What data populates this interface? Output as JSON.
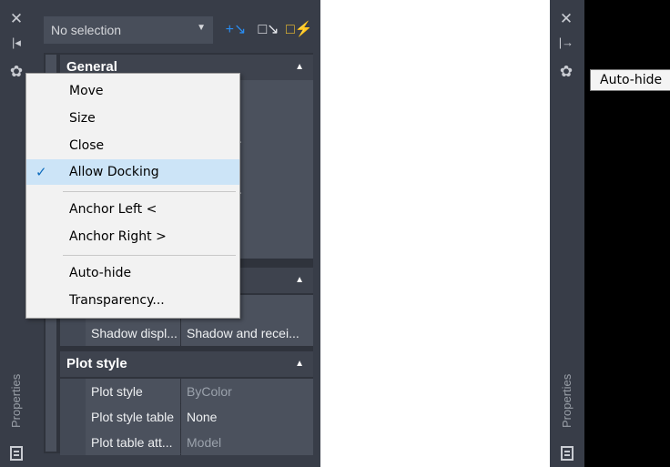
{
  "left": {
    "title_vertical": "Properties",
    "selection_combo": "No selection",
    "sections": [
      {
        "title": "General"
      },
      {
        "title": "Plot style"
      }
    ],
    "behind_values": [
      "yer",
      "- ByLayer",
      "- ByLayer"
    ],
    "shadow_row": {
      "name": "Shadow displ...",
      "value": "Shadow and recei..."
    },
    "plot_rows": [
      {
        "name": "Plot style",
        "value": "ByColor"
      },
      {
        "name": "Plot style table",
        "value": "None"
      },
      {
        "name": "Plot table att...",
        "value": "Model"
      }
    ]
  },
  "menu": {
    "items": [
      {
        "label": "Move"
      },
      {
        "label": "Size"
      },
      {
        "label": "Close"
      },
      {
        "label": "Allow Docking",
        "checked": true
      },
      {
        "label": "Anchor Left <"
      },
      {
        "label": "Anchor Right >"
      },
      {
        "label": "Auto-hide"
      },
      {
        "label": "Transparency..."
      }
    ],
    "check_glyph": "✓"
  },
  "right": {
    "title_vertical": "Properties",
    "tooltip": "Auto-hide"
  },
  "icons": {
    "close": "✕",
    "autohide_collapsed": "|◂",
    "autohide_expanded": "|→",
    "settings": "✿",
    "section_collapse": "▲",
    "combo_arrow": "▼",
    "quickselect": "+↘",
    "select_objects": "□↘",
    "toggle_pickadd": "□⚡"
  },
  "colors": {
    "panel_bg": "#383d48",
    "grid_cell": "#4b515d",
    "menu_bg": "#f2f2f2",
    "menu_check_bg": "#cce4f7",
    "accent_blue": "#2a8cf0",
    "accent_yellow": "#f2c230"
  }
}
